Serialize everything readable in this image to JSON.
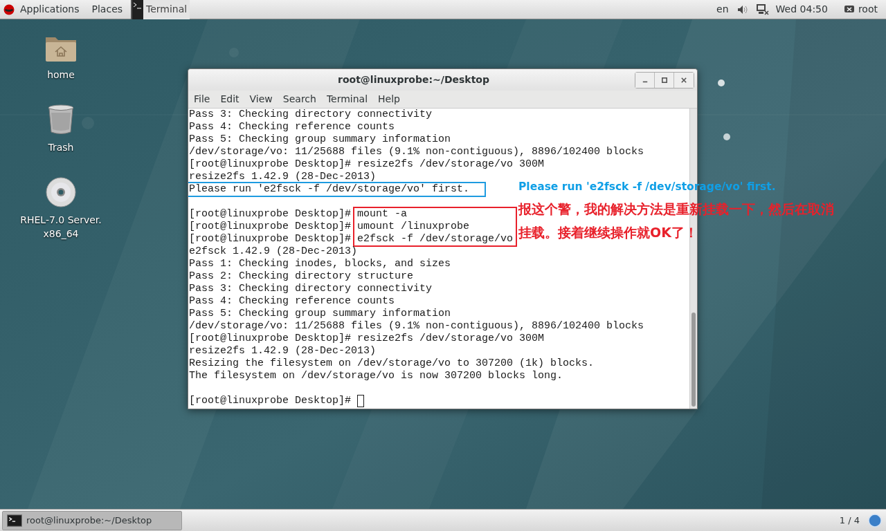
{
  "top_bar": {
    "menus": [
      "Applications",
      "Places"
    ],
    "active_app": "Terminal",
    "language": "en",
    "clock": "Wed 04:50",
    "user": "root"
  },
  "desktop_icons": [
    {
      "kind": "folder",
      "label": "home"
    },
    {
      "kind": "trash",
      "label": "Trash"
    },
    {
      "kind": "disc",
      "label": "RHEL-7.0 Server.\nx86_64"
    }
  ],
  "window": {
    "title": "root@linuxprobe:~/Desktop",
    "menu": [
      "File",
      "Edit",
      "View",
      "Search",
      "Terminal",
      "Help"
    ],
    "lines": [
      {
        "kind": "output",
        "text": "Pass 3: Checking directory connectivity"
      },
      {
        "kind": "output",
        "text": "Pass 4: Checking reference counts"
      },
      {
        "kind": "output",
        "text": "Pass 5: Checking group summary information"
      },
      {
        "kind": "output",
        "text": "/dev/storage/vo: 11/25688 files (9.1% non-contiguous), 8896/102400 blocks"
      },
      {
        "kind": "prompt",
        "prompt": "[root@linuxprobe Desktop]#",
        "command": "resize2fs /dev/storage/vo 300M"
      },
      {
        "kind": "output",
        "text": "resize2fs 1.42.9 (28-Dec-2013)"
      },
      {
        "kind": "output",
        "text": "Please run 'e2fsck -f /dev/storage/vo' first.",
        "color": "#1e9be0"
      },
      {
        "kind": "blank"
      },
      {
        "kind": "prompt",
        "prompt": "[root@linuxprobe Desktop]#",
        "command": "mount -a",
        "color": "#e8212b"
      },
      {
        "kind": "prompt",
        "prompt": "[root@linuxprobe Desktop]#",
        "command": "umount /linuxprobe",
        "color": "#e8212b"
      },
      {
        "kind": "prompt",
        "prompt": "[root@linuxprobe Desktop]#",
        "command": "e2fsck -f /dev/storage/vo",
        "color": "#e8212b"
      },
      {
        "kind": "output",
        "text": "e2fsck 1.42.9 (28-Dec-2013)"
      },
      {
        "kind": "output",
        "text": "Pass 1: Checking inodes, blocks, and sizes"
      },
      {
        "kind": "output",
        "text": "Pass 2: Checking directory structure"
      },
      {
        "kind": "output",
        "text": "Pass 3: Checking directory connectivity"
      },
      {
        "kind": "output",
        "text": "Pass 4: Checking reference counts"
      },
      {
        "kind": "output",
        "text": "Pass 5: Checking group summary information"
      },
      {
        "kind": "output",
        "text": "/dev/storage/vo: 11/25688 files (9.1% non-contiguous), 8896/102400 blocks"
      },
      {
        "kind": "prompt",
        "prompt": "[root@linuxprobe Desktop]#",
        "command": "resize2fs /dev/storage/vo 300M"
      },
      {
        "kind": "output",
        "text": "resize2fs 1.42.9 (28-Dec-2013)"
      },
      {
        "kind": "output",
        "text": "Resizing the filesystem on /dev/storage/vo to 307200 (1k) blocks."
      },
      {
        "kind": "output",
        "text": "The filesystem on /dev/storage/vo is now 307200 blocks long."
      },
      {
        "kind": "blank"
      },
      {
        "kind": "prompt",
        "prompt": "[root@linuxprobe Desktop]#",
        "cursor": true
      }
    ]
  },
  "annotations": [
    {
      "kind": "warning",
      "text": "Please run 'e2fsck -f /dev/storage/vo' first.",
      "color": "#0f9fe6"
    },
    {
      "kind": "note",
      "text": "报这个警，我的解决方法是重新挂载一下，然后在取消挂载。接着继续操作就OK了！",
      "color": "#e8212b"
    }
  ],
  "task_bar": {
    "window": "root@linuxprobe:~/Desktop",
    "workspace": "1 / 4"
  }
}
